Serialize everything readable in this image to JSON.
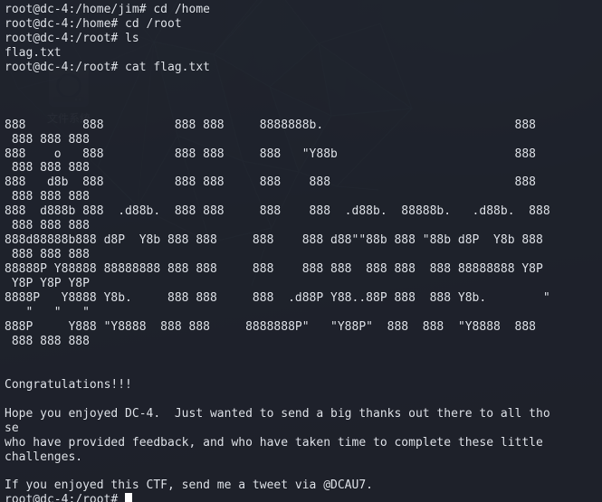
{
  "window": {
    "kind": "terminal-emulator",
    "columns": 78,
    "background_color": "#1e222b",
    "foreground_color": "#dfe3ea",
    "cursor_color": "#ffffff",
    "transparency": "semi-transparent"
  },
  "desktop": {
    "icon": {
      "name": "file-system",
      "label": "文件系统",
      "glyph": "hard-drive"
    },
    "wallpaper_colors": {
      "base": "#232832",
      "wireframe": "#3c5c62"
    }
  },
  "session": {
    "user": "root",
    "host": "dc-4",
    "prompt_symbol": "#"
  },
  "terminal_lines": [
    "root@dc-4:/home/jim# cd /home",
    "root@dc-4:/home# cd /root",
    "root@dc-4:/root# ls",
    "flag.txt",
    "root@dc-4:/root# cat flag.txt",
    "",
    "",
    "",
    "888        888          888 888     8888888b.                           888",
    " 888 888 888",
    "888    o   888          888 888     888   \"Y88b                         888",
    " 888 888 888",
    "888   d8b  888          888 888     888    888                          888",
    " 888 888 888",
    "888  d888b 888  .d88b.  888 888     888    888  .d88b.  88888b.   .d88b.  888",
    " 888 888 888",
    "888d88888b888 d8P  Y8b 888 888     888    888 d88\"\"88b 888 \"88b d8P  Y8b 888",
    " 888 888 888",
    "88888P Y88888 88888888 888 888     888    888 888  888 888  888 88888888 Y8P",
    " Y8P Y8P Y8P",
    "8888P   Y8888 Y8b.     888 888     888  .d88P Y88..88P 888  888 Y8b.        \"",
    "   \"   \"   \"",
    "888P     Y888 \"Y8888  888 888     8888888P\"   \"Y88P\"  888  888  \"Y8888  888",
    " 888 888 888",
    "",
    "",
    "Congratulations!!!",
    "",
    "Hope you enjoyed DC-4.  Just wanted to send a big thanks out there to all tho",
    "se",
    "who have provided feedback, and who have taken time to complete these little",
    "challenges.",
    "",
    "If you enjoyed this CTF, send me a tweet via @DCAU7."
  ],
  "final_prompt": "root@dc-4:/root# ",
  "messages": {
    "congratulations": "Congratulations!!!",
    "thanks": "Hope you enjoyed DC-4.  Just wanted to send a big thanks out there to all those who have provided feedback, and who have taken time to complete these little challenges.",
    "tweet": "If you enjoyed this CTF, send me a tweet via @DCAU7.",
    "twitter_handle": "@DCAU7"
  },
  "commands": [
    "cd /home",
    "cd /root",
    "ls",
    "cat flag.txt"
  ],
  "files": [
    "flag.txt"
  ]
}
